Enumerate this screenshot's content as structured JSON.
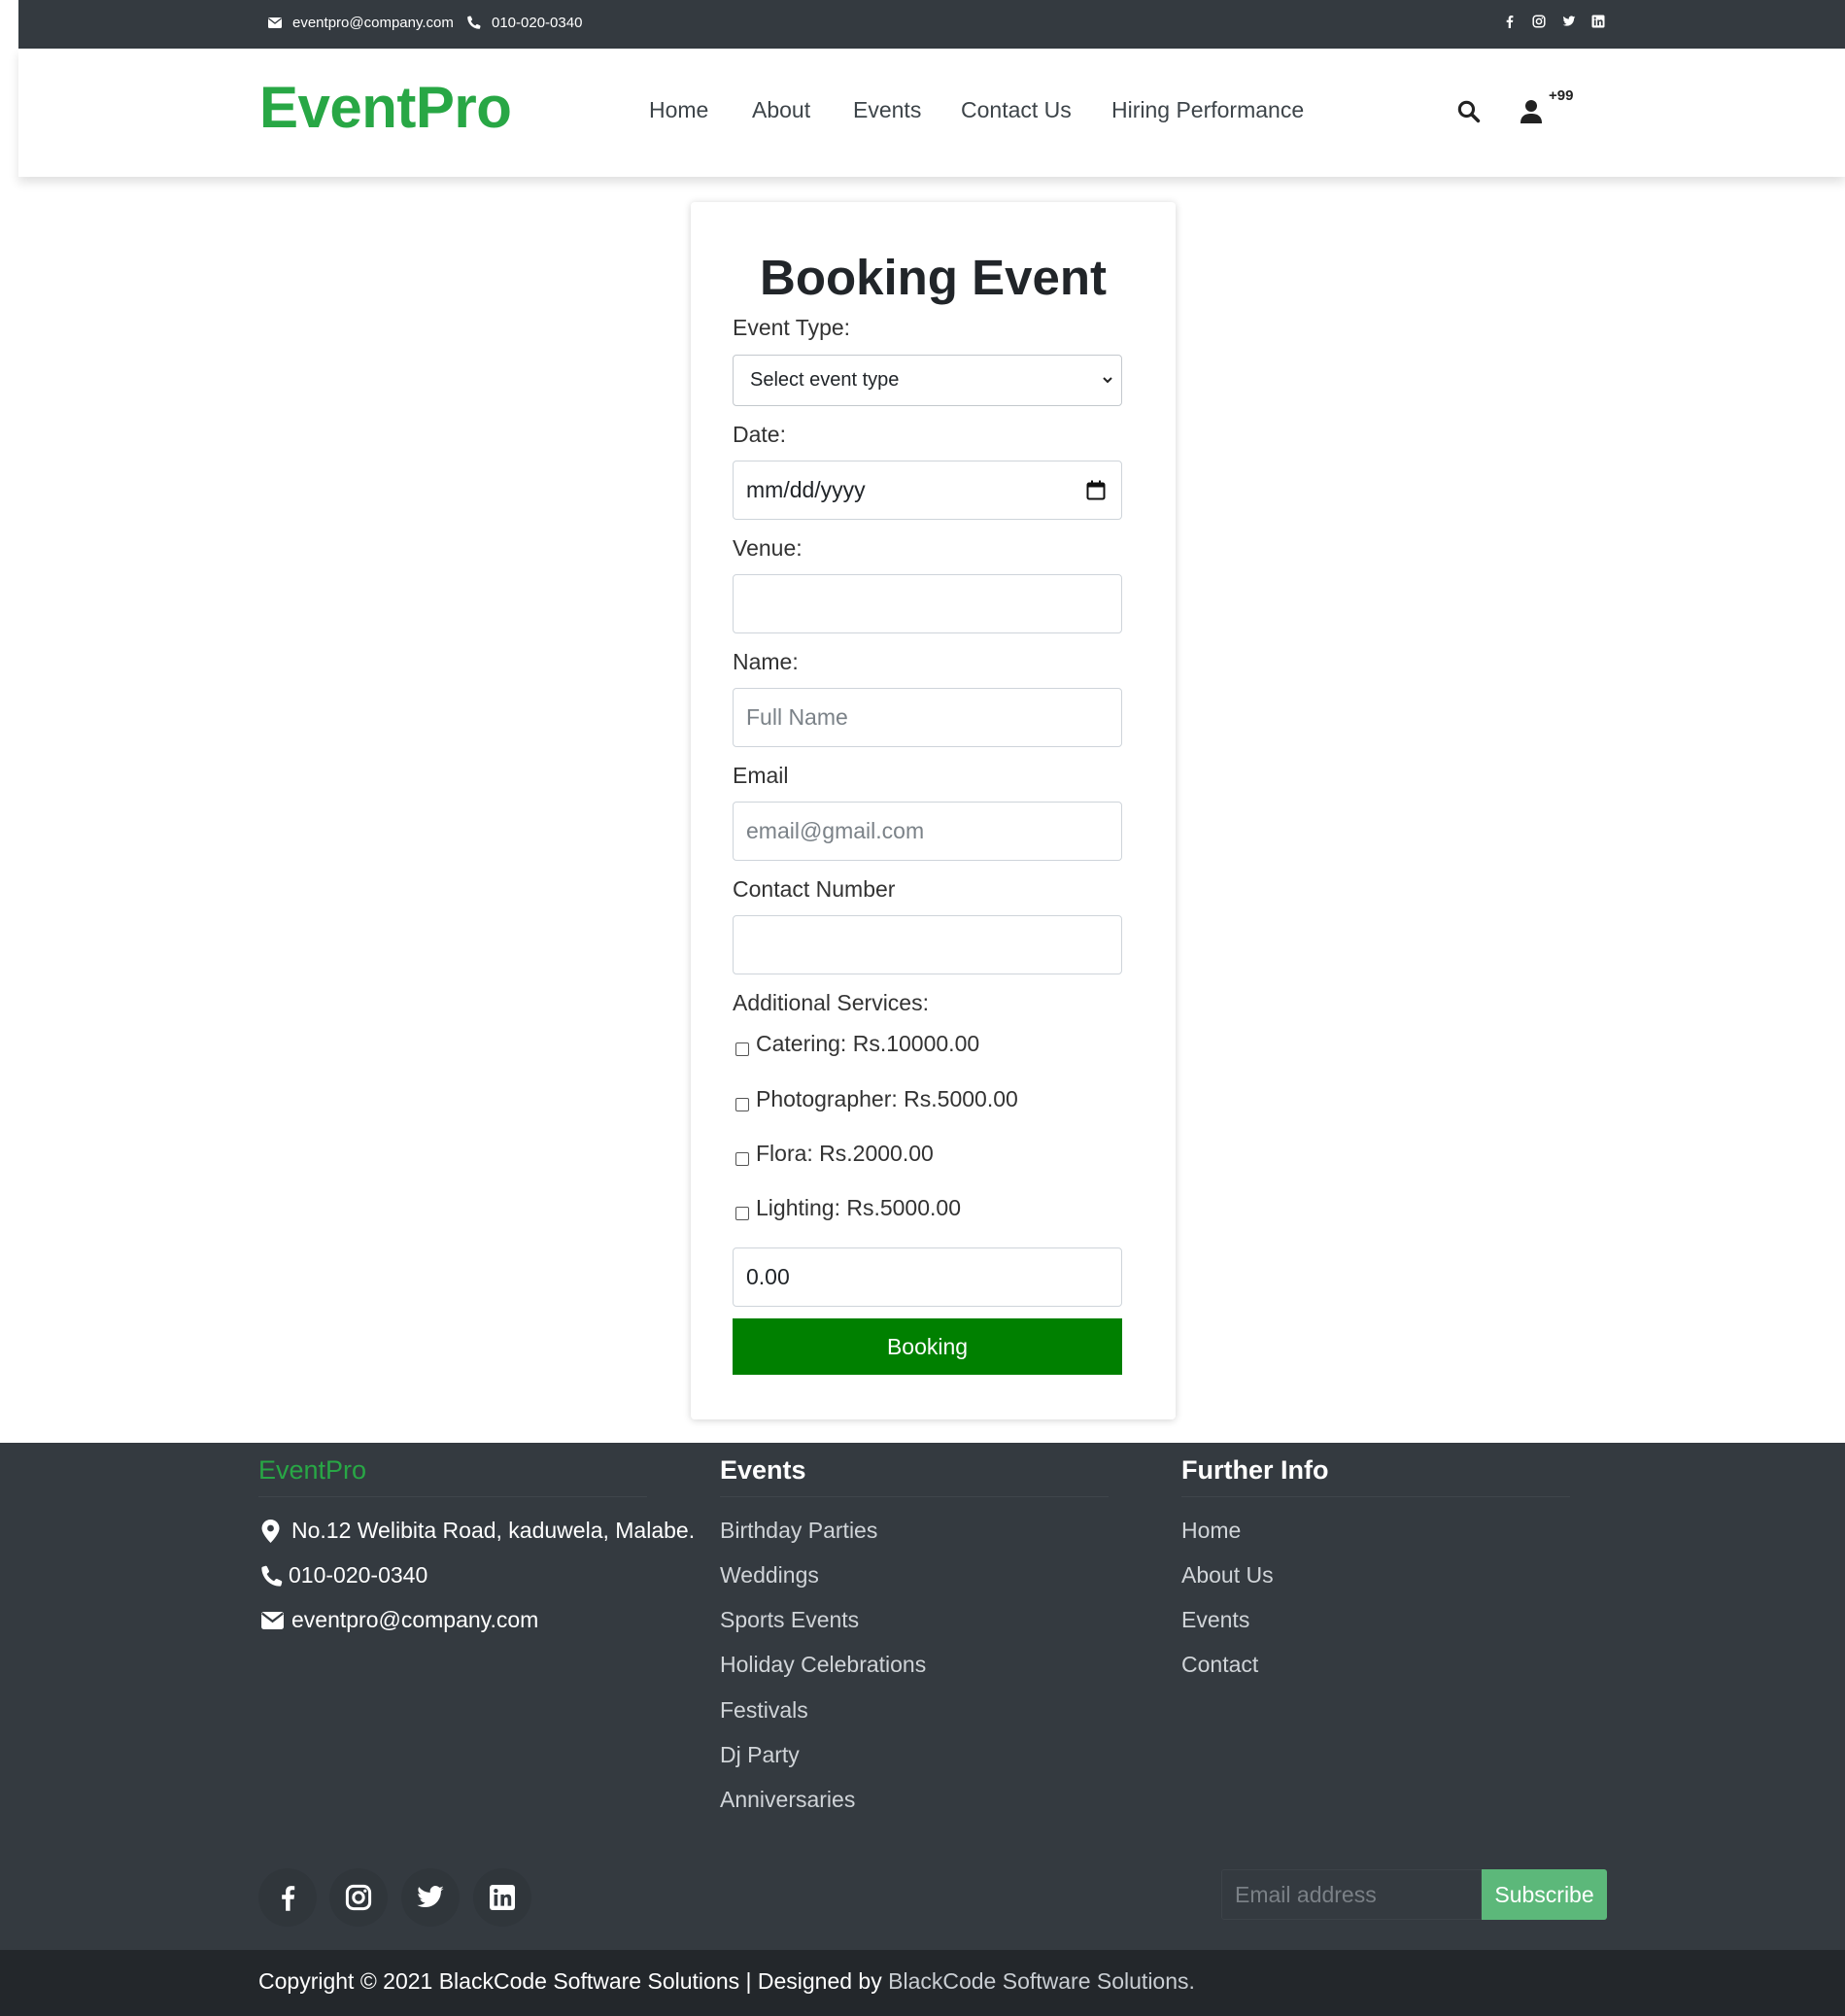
{
  "topbar": {
    "email": "eventpro@company.com",
    "phone": "010-020-0340",
    "social_icons": [
      "facebook-icon",
      "instagram-icon",
      "twitter-icon",
      "linkedin-icon"
    ]
  },
  "header": {
    "logo": "EventPro",
    "nav": [
      "Home",
      "About",
      "Events",
      "Contact Us",
      "Hiring Performance"
    ],
    "cart_badge": "+99",
    "colors": {
      "brand": "#28a745"
    }
  },
  "form": {
    "title": "Booking Event",
    "event_type_label": "Event Type:",
    "event_type_value": "Select event type",
    "date_label": "Date:",
    "date_value": "mm/dd/yyyy",
    "venue_label": "Venue:",
    "venue_value": "",
    "name_label": "Name:",
    "name_placeholder": "Full Name",
    "email_label": "Email",
    "email_placeholder": "email@gmail.com",
    "contact_label": "Contact Number",
    "contact_value": "",
    "services_label": "Additional Services:",
    "services": [
      {
        "label": "Catering: Rs.10000.00",
        "checked": false
      },
      {
        "label": "Photographer: Rs.5000.00",
        "checked": false
      },
      {
        "label": "Flora: Rs.2000.00",
        "checked": false
      },
      {
        "label": "Lighting: Rs.5000.00",
        "checked": false
      }
    ],
    "total_value": "0.00",
    "submit_label": "Booking",
    "colors": {
      "submit": "#008000"
    }
  },
  "footer": {
    "brand": "EventPro",
    "contact": {
      "address": "No.12 Welibita Road, kaduwela, Malabe.",
      "phone": "010-020-0340",
      "email": "eventpro@company.com"
    },
    "events_heading": "Events",
    "events_links": [
      "Birthday Parties",
      "Weddings",
      "Sports Events",
      "Holiday Celebrations",
      "Festivals",
      "Dj Party",
      "Anniversaries"
    ],
    "info_heading": "Further Info",
    "info_links": [
      "Home",
      "About Us",
      "Events",
      "Contact"
    ],
    "newsletter": {
      "placeholder": "Email address",
      "button": "Subscribe"
    },
    "social_icons": [
      "facebook-icon",
      "instagram-icon",
      "twitter-icon",
      "linkedin-icon"
    ],
    "copyright_text": "Copyright © 2021 BlackCode Software Solutions | Designed by ",
    "copyright_link": "BlackCode Software Solutions."
  }
}
